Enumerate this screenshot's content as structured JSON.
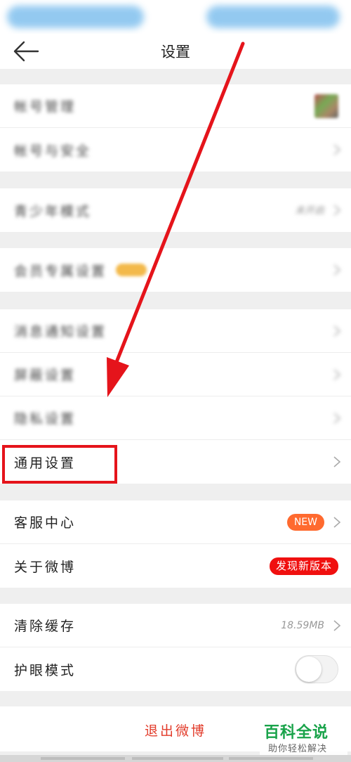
{
  "header": {
    "title": "设置",
    "back_icon": "back-arrow-icon"
  },
  "groups": [
    {
      "rows": [
        {
          "label": "帐号管理",
          "blurred": true,
          "right": "thumbnail"
        },
        {
          "label": "帐号与安全",
          "blurred": true,
          "right": "chevron"
        }
      ]
    },
    {
      "rows": [
        {
          "label": "青少年模式",
          "blurred": true,
          "value": "未开启",
          "right": "chevron"
        }
      ]
    },
    {
      "rows": [
        {
          "label": "会员专属设置",
          "blurred": true,
          "badge": "vip",
          "right": "chevron"
        }
      ]
    },
    {
      "rows": [
        {
          "label": "消息通知设置",
          "blurred": true,
          "right": "chevron"
        },
        {
          "label": "屏蔽设置",
          "blurred": true,
          "right": "chevron"
        },
        {
          "label": "隐私设置",
          "blurred": true,
          "right": "chevron"
        },
        {
          "label": "通用设置",
          "blurred": false,
          "right": "chevron"
        }
      ]
    },
    {
      "rows": [
        {
          "label": "客服中心",
          "blurred": false,
          "badge_text": "NEW",
          "right": "chevron"
        },
        {
          "label": "关于微博",
          "blurred": false,
          "badge_text": "发现新版本",
          "right": "none"
        }
      ]
    },
    {
      "rows": [
        {
          "label": "清除缓存",
          "blurred": false,
          "value": "18.59MB",
          "right": "chevron"
        },
        {
          "label": "护眼模式",
          "blurred": false,
          "right": "toggle",
          "toggle_on": false
        }
      ]
    }
  ],
  "logout_label": "退出微博",
  "watermark": {
    "main": "百科全说",
    "sub": "助你轻松解决"
  },
  "colors": {
    "accent_red": "#e5141b",
    "logout_red": "#e23b2a",
    "new_badge": "#ff6a2f",
    "version_badge": "#f0100f",
    "watermark_green": "#19a34a",
    "status_blur": "#8ec7f0"
  }
}
